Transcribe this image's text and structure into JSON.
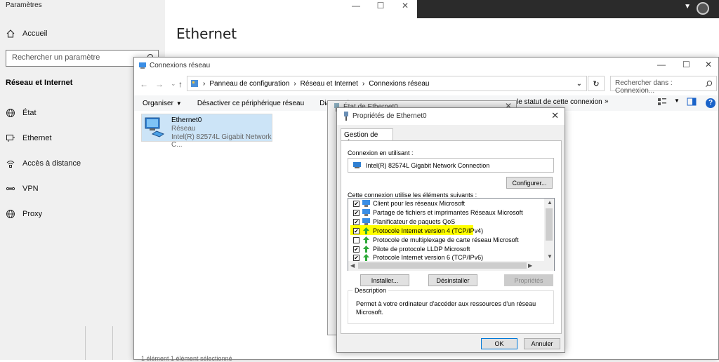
{
  "settings": {
    "title": "Paramètres",
    "home_label": "Accueil",
    "search_placeholder": "Rechercher un paramètre",
    "section_title": "Réseau et Internet",
    "nav": [
      {
        "label": "État",
        "icon": "globe-status-icon"
      },
      {
        "label": "Ethernet",
        "icon": "ethernet-icon"
      },
      {
        "label": "Accès à distance",
        "icon": "dialup-icon"
      },
      {
        "label": "VPN",
        "icon": "vpn-icon"
      },
      {
        "label": "Proxy",
        "icon": "globe-icon"
      }
    ],
    "page_heading": "Ethernet"
  },
  "explorer": {
    "title": "Connexions réseau",
    "breadcrumb": [
      "Panneau de configuration",
      "Réseau et Internet",
      "Connexions réseau"
    ],
    "search_placeholder": "Rechercher dans : Connexion...",
    "toolbar": {
      "organize": "Organiser",
      "disable": "Désactiver ce périphérique réseau",
      "diagnose": "Diagnosti",
      "status": "le statut de cette connexion",
      "more": "»"
    },
    "connection": {
      "name": "Ethernet0",
      "type": "Réseau",
      "adapter": "Intel(R) 82574L Gigabit Network C..."
    },
    "status_text": "1 élément   1 élément sélectionné"
  },
  "etat_dialog": {
    "title": "État de Ethernet0"
  },
  "props_dialog": {
    "title": "Propriétés de Ethernet0",
    "tab": "Gestion de réseau",
    "connect_using_label": "Connexion en utilisant :",
    "adapter": "Intel(R) 82574L Gigabit Network Connection",
    "configure": "Configurer...",
    "items_label": "Cette connexion utilise les éléments suivants :",
    "items": [
      {
        "label": "Client pour les réseaux Microsoft",
        "checked": true
      },
      {
        "label": "Partage de fichiers et imprimantes Réseaux Microsoft",
        "checked": true
      },
      {
        "label": "Planificateur de paquets QoS",
        "checked": true
      },
      {
        "label": "Protocole Internet version 4 (TCP/IPv4)",
        "checked": true,
        "highlighted": true
      },
      {
        "label": "Protocole de multiplexage de carte réseau Microsoft",
        "checked": false
      },
      {
        "label": "Pilote de protocole LLDP Microsoft",
        "checked": true
      },
      {
        "label": "Protocole Internet version 6 (TCP/IPv6)",
        "checked": true
      }
    ],
    "install": "Installer...",
    "uninstall": "Désinstaller",
    "properties": "Propriétés",
    "description_legend": "Description",
    "description": "Permet à votre ordinateur d'accéder aux ressources d'un réseau Microsoft.",
    "ok": "OK",
    "cancel": "Annuler"
  },
  "colors": {
    "highlight": "#ffff00",
    "selection": "#cce4f7",
    "accent": "#0078d7"
  }
}
